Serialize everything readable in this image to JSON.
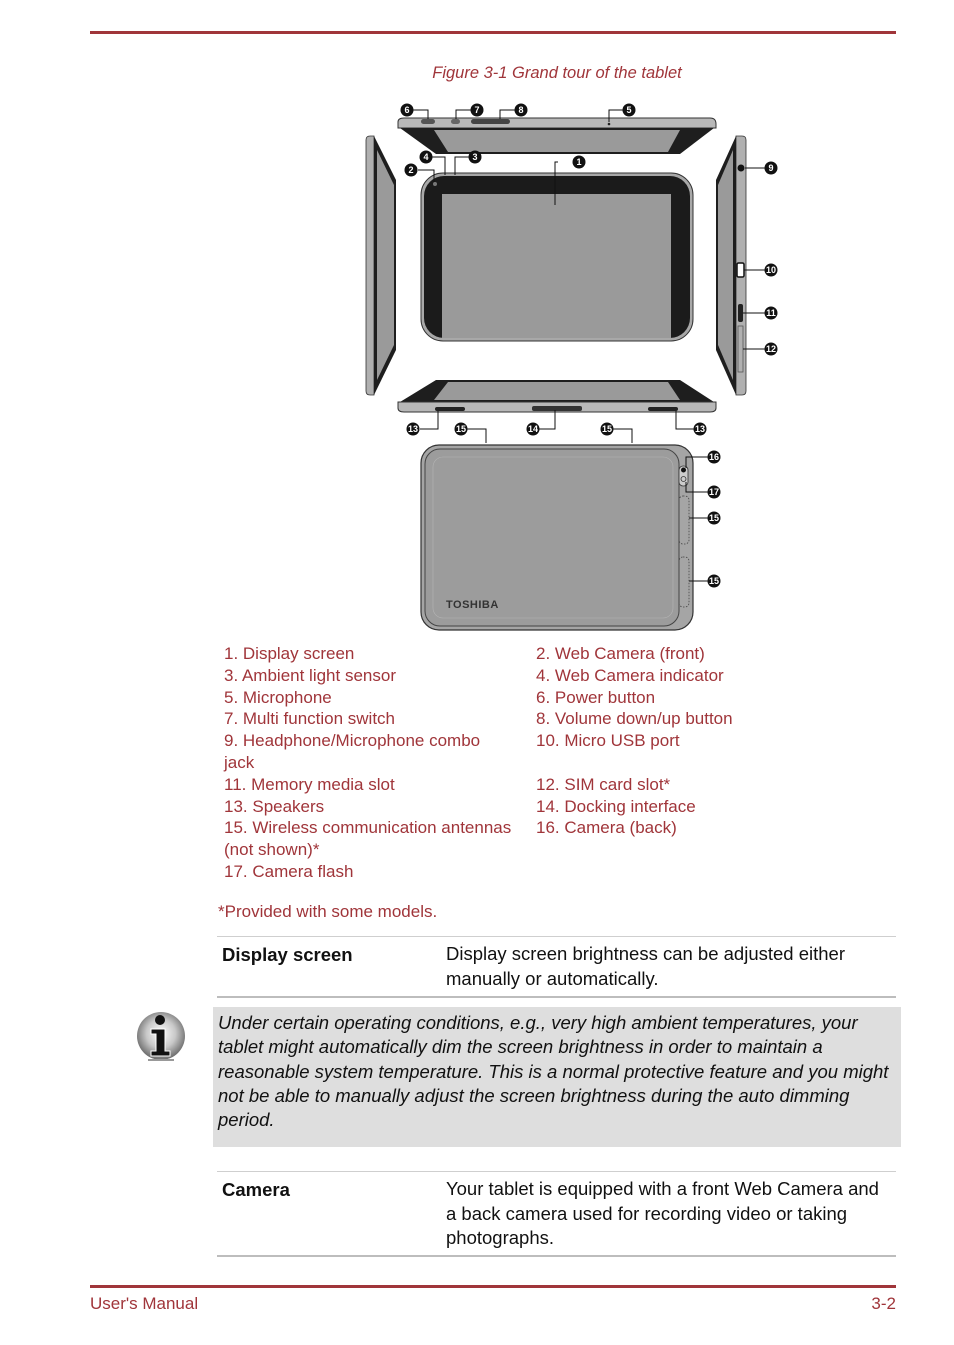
{
  "page": {
    "header_rule_color": "#a0353a",
    "accent_color": "#a0353a"
  },
  "figure": {
    "caption": "Figure 3-1 Grand tour of the tablet",
    "brand_logo": "TOSHIBA",
    "callouts": [
      "1",
      "2",
      "3",
      "4",
      "5",
      "6",
      "7",
      "8",
      "9",
      "10",
      "11",
      "12",
      "13",
      "13",
      "14",
      "15",
      "15",
      "15",
      "15",
      "16",
      "17"
    ]
  },
  "legend": {
    "left": [
      "1. Display screen",
      "3. Ambient light sensor",
      "5. Microphone",
      "7. Multi function switch",
      "9. Headphone/Microphone combo jack",
      "11. Memory media slot",
      "13. Speakers",
      "15. Wireless communication antennas (not shown)*",
      "17. Camera flash"
    ],
    "right": [
      "2. Web Camera (front)",
      "4. Web Camera indicator",
      "6. Power button",
      "8. Volume down/up button",
      "10. Micro USB port",
      "12. SIM card slot*",
      "14. Docking interface",
      "16. Camera (back)"
    ]
  },
  "footnote": "*Provided with some models.",
  "definitions": {
    "display": {
      "term": "Display screen",
      "description": "Display screen brightness can be adjusted either manually or automatically."
    },
    "camera": {
      "term": "Camera",
      "description": "Your tablet is equipped with a front Web Camera and a back camera used for recording video or taking photographs."
    }
  },
  "note": {
    "icon": "info-icon",
    "text": "Under certain operating conditions, e.g., very high ambient temperatures, your tablet might automatically dim the screen brightness in order to maintain a reasonable system temperature. This is a normal protective feature and you might not be able to manually adjust the screen brightness during the auto dimming period."
  },
  "footer": {
    "left": "User's Manual",
    "right": "3-2"
  }
}
